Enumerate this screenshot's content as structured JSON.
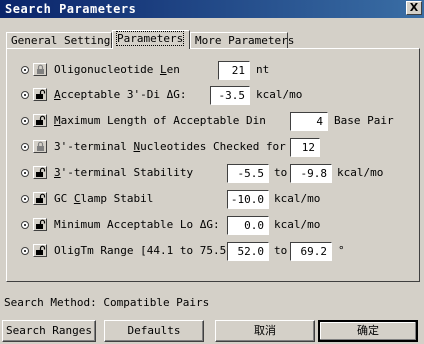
{
  "window": {
    "title": "Search Parameters",
    "close_label": "X"
  },
  "tabs": [
    {
      "label": "General Settings",
      "active": false
    },
    {
      "label": "Parameters",
      "active": true
    },
    {
      "label": "More Parameters",
      "active": false
    }
  ],
  "rows": [
    {
      "label_pre": "Oligonucleotide ",
      "label_u": "L",
      "label_post": "en",
      "v1": "21",
      "unit": "nt",
      "locked": true
    },
    {
      "label_pre": "",
      "label_u": "A",
      "label_post": "cceptable 3'-Di ΔG:",
      "v1": "-3.5",
      "unit": "kcal/mo",
      "locked": false
    },
    {
      "label_pre": "",
      "label_u": "M",
      "label_post": "aximum Length of Acceptable Din",
      "v1": "4",
      "unit": "Base Pair",
      "locked": false
    },
    {
      "label_pre": "3'-terminal ",
      "label_u": "N",
      "label_post": "ucleotides Checked for",
      "v1": "12",
      "unit": "",
      "locked": true
    },
    {
      "label_pre": "",
      "label_u": "3",
      "label_post": "'-terminal Stability",
      "v1": "-5.5",
      "to": "to",
      "v2": "-9.8",
      "unit": "kcal/mo",
      "locked": false
    },
    {
      "label_pre": "GC ",
      "label_u": "C",
      "label_post": "lamp Stabil",
      "v1": "-10.0",
      "unit": "kcal/mo",
      "locked": false
    },
    {
      "label_pre": "Minimum Acceptable Lo ΔG:",
      "label_u": "",
      "label_post": "",
      "v1": "0.0",
      "unit": "kcal/mo",
      "locked": false
    },
    {
      "label_pre": "Olig",
      "label_u": "",
      "label_post": "Tm  Range [44.1 to 75.5]",
      "v1": "52.0",
      "to": "to",
      "v2": "69.2",
      "unit": "°",
      "locked": false
    }
  ],
  "status": {
    "method": "Search Method: Compatible Pairs"
  },
  "buttons": {
    "search_ranges": "Search Ranges",
    "defaults": "Defaults",
    "cancel": "取消",
    "ok": "确定"
  }
}
